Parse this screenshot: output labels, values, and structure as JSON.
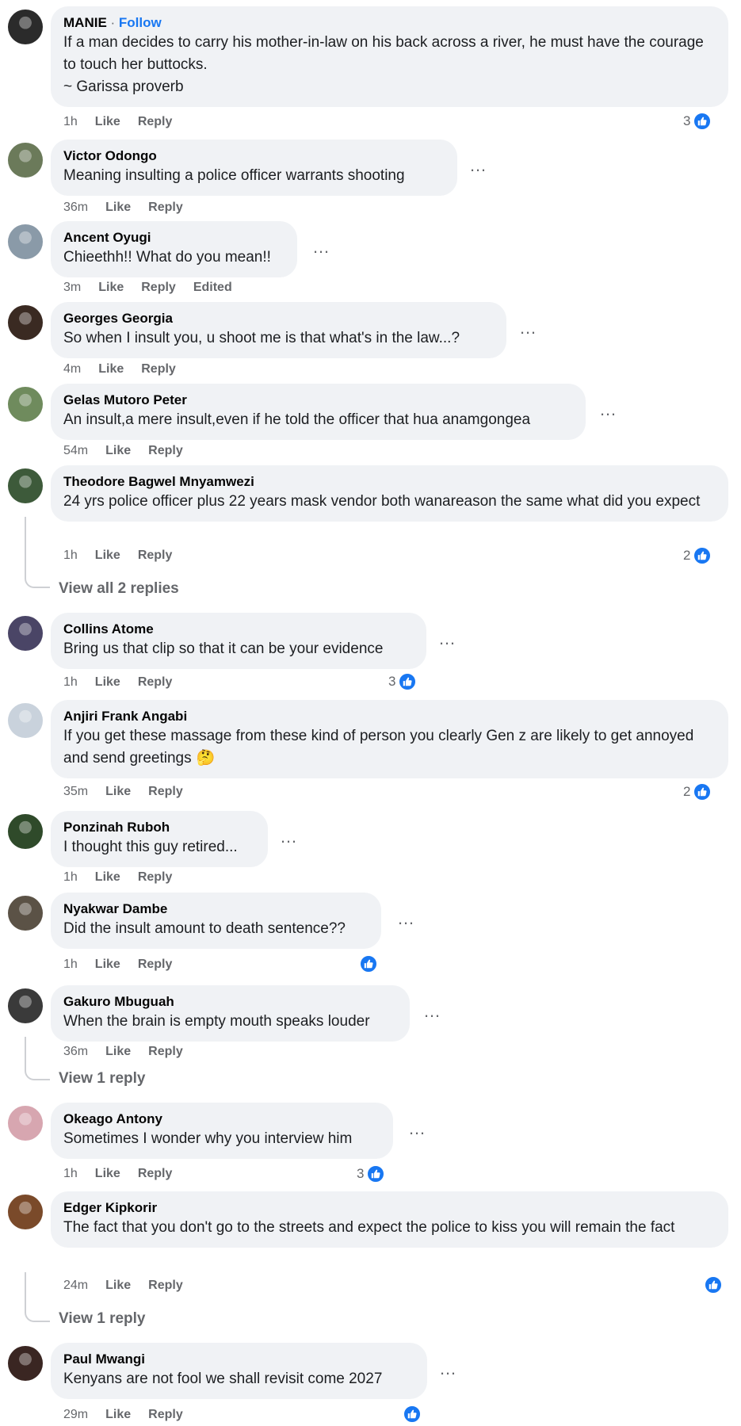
{
  "comments": [
    {
      "name": "MANIE",
      "follow_sep": " · ",
      "follow": "Follow",
      "text": "If a man decides to carry his mother-in-law on his back across a river, he must have the courage to touch her buttocks.\n~ Garissa proverb",
      "time": "1h",
      "like": "Like",
      "reply": "Reply",
      "reactions": "3",
      "avatar_color": "#2b2b2b"
    },
    {
      "name": "Victor Odongo",
      "text": "Meaning insulting a police officer warrants shooting",
      "time": "36m",
      "like": "Like",
      "reply": "Reply",
      "avatar_color": "#6b7a5a"
    },
    {
      "name": "Ancent Oyugi",
      "text": "Chieethh!! What do you mean!!",
      "time": "3m",
      "like": "Like",
      "reply": "Reply",
      "edited": "Edited",
      "avatar_color": "#8a9aa8"
    },
    {
      "name": "Georges Georgia",
      "text": "So when I insult you, u shoot me is that what's in the law...?",
      "time": "4m",
      "like": "Like",
      "reply": "Reply",
      "avatar_color": "#3a2a22"
    },
    {
      "name": "Gelas Mutoro Peter",
      "text": "An insult,a mere insult,even if he told the officer that hua anamgongea",
      "time": "54m",
      "like": "Like",
      "reply": "Reply",
      "avatar_color": "#6f8b5d"
    },
    {
      "name": "Theodore Bagwel Mnyamwezi",
      "text": "24 yrs police officer plus 22 years mask vendor both wanareason the same what did you expect",
      "time": "1h",
      "like": "Like",
      "reply": "Reply",
      "reactions": "2",
      "view_replies": "View all 2 replies",
      "avatar_color": "#3d5a3a"
    },
    {
      "name": "Collins Atome",
      "text": "Bring us that clip so that it can be your evidence",
      "time": "1h",
      "like": "Like",
      "reply": "Reply",
      "reactions": "3",
      "avatar_color": "#4a4566"
    },
    {
      "name": "Anjiri Frank Angabi",
      "text": "If you get these massage from these kind of person you clearly Gen z are likely to get annoyed and send greetings",
      "emoji": "🤔",
      "time": "35m",
      "like": "Like",
      "reply": "Reply",
      "reactions": "2",
      "avatar_color": "#c9d2dc"
    },
    {
      "name": "Ponzinah Ruboh",
      "text": "I thought this guy retired...",
      "time": "1h",
      "like": "Like",
      "reply": "Reply",
      "avatar_color": "#2f4a2a"
    },
    {
      "name": "Nyakwar Dambe",
      "text": "Did the insult amount to death sentence??",
      "time": "1h",
      "like": "Like",
      "reply": "Reply",
      "reactions": "",
      "avatar_color": "#5b5246"
    },
    {
      "name": "Gakuro Mbuguah",
      "text": "When the brain is empty mouth speaks louder",
      "time": "36m",
      "like": "Like",
      "reply": "Reply",
      "view_replies": "View 1 reply",
      "avatar_color": "#3a3a3a"
    },
    {
      "name": "Okeago Antony",
      "text": "Sometimes I wonder why you interview him",
      "time": "1h",
      "like": "Like",
      "reply": "Reply",
      "reactions": "3",
      "avatar_color": "#d7a6b0"
    },
    {
      "name": "Edger Kipkorir",
      "text": "The fact that you don't go to the streets and expect the police to kiss you will remain the fact",
      "time": "24m",
      "like": "Like",
      "reply": "Reply",
      "reactions": "",
      "view_replies": "View 1 reply",
      "avatar_color": "#7a4a2a"
    },
    {
      "name": "Paul Mwangi",
      "text": "Kenyans are not fool we shall revisit come 2027",
      "time": "29m",
      "like": "Like",
      "reply": "Reply",
      "reactions": "",
      "avatar_color": "#3a2622"
    }
  ],
  "colors": {
    "accent": "#1877f2",
    "bubble": "#f0f2f5",
    "meta": "#65676b"
  }
}
